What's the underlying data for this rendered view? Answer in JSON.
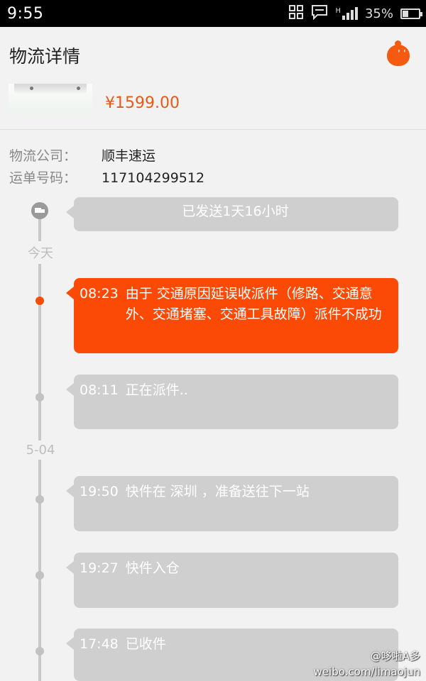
{
  "status_bar": {
    "time": "9:55",
    "network_label": "H",
    "battery_text": "35%",
    "battery_level": 0.35,
    "icons": [
      "qr-scan-icon",
      "message-icon",
      "signal-icon",
      "battery-icon"
    ]
  },
  "header": {
    "title": "物流详情",
    "mascot_icon": "mascot-icon"
  },
  "product": {
    "price": "¥1599.00"
  },
  "info": {
    "company_label": "物流公司：",
    "company_value": "顺丰速运",
    "tracking_label": "运单号码：",
    "tracking_value": "117104299512"
  },
  "timeline": {
    "summary": "已发送1天16小时",
    "dates": [
      "今天",
      "5-04"
    ],
    "events": [
      {
        "time": "08:23",
        "text": "由于 交通原因延误收派件（修路、交通意外、交通堵塞、交通工具故障）派件不成功"
      },
      {
        "time": "08:11",
        "text": "正在派件.."
      },
      {
        "time": "19:50",
        "text": "快件在 深圳 ，准备送往下一站"
      },
      {
        "time": "19:27",
        "text": "快件入仓"
      },
      {
        "time": "17:48",
        "text": "已收件"
      }
    ]
  },
  "watermark": {
    "line1": "@哆啦A多",
    "line2": "weibo.com/limaojun"
  },
  "colors": {
    "accent": "#fb4a06",
    "price": "#e65a14",
    "bubble_gray": "#cfcfcf",
    "background": "#f2f2f2"
  }
}
